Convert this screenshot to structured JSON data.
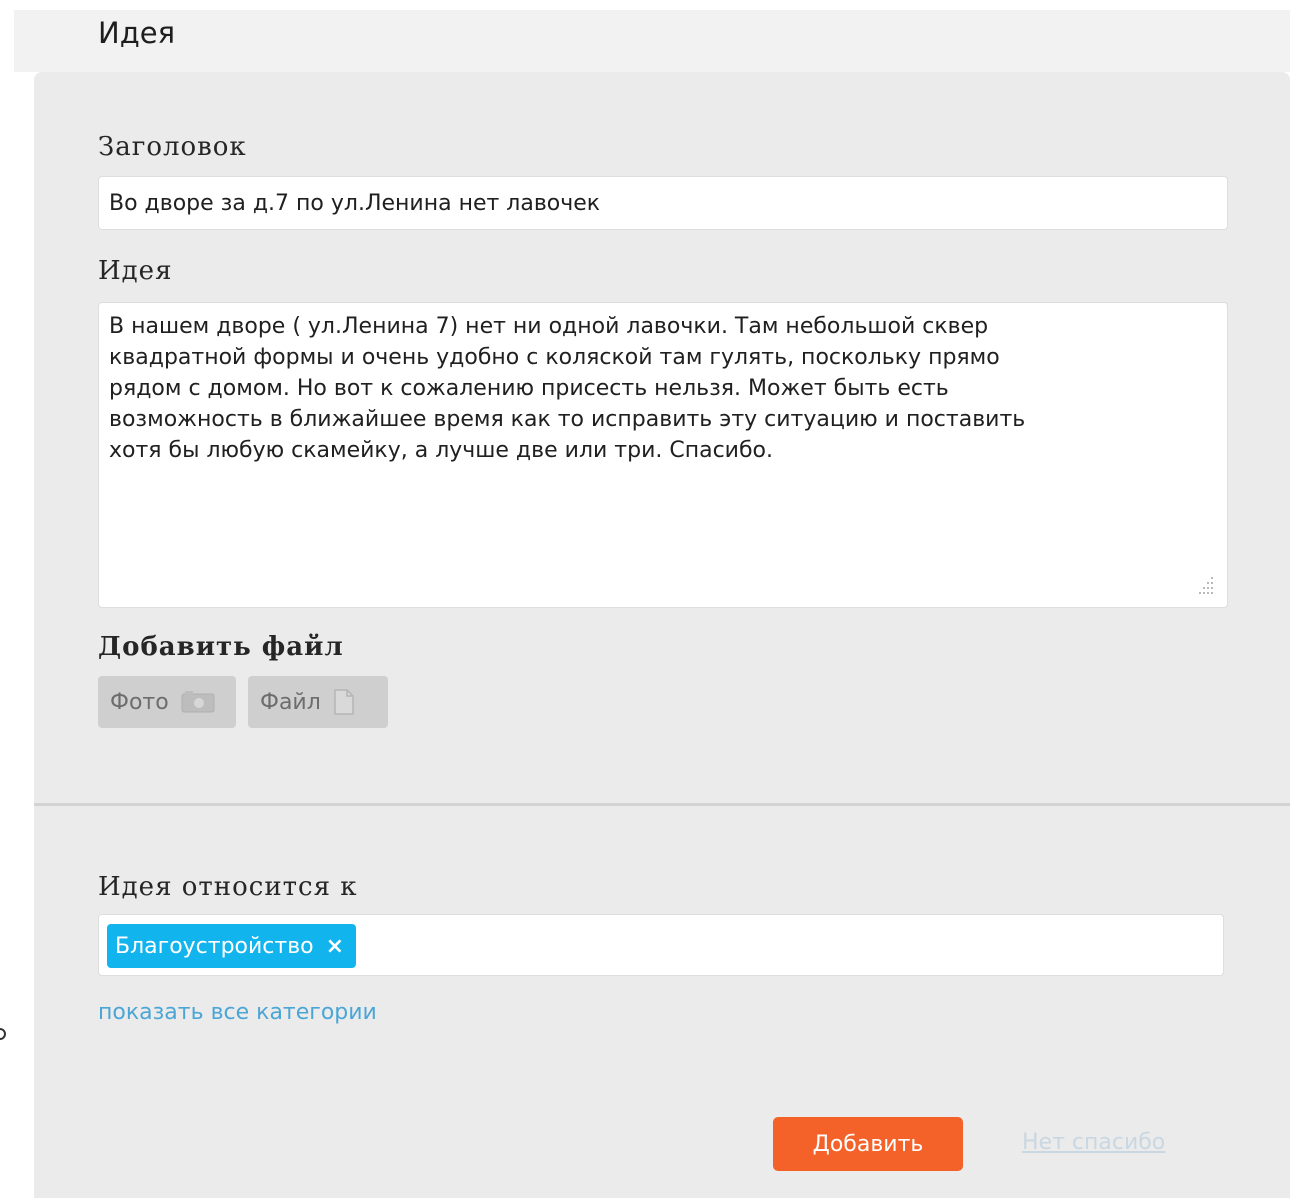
{
  "header": {
    "title": "Идея"
  },
  "form": {
    "title_label": "Заголовок",
    "title_value": "Во дворе за д.7 по ул.Ленина нет лавочек",
    "idea_label": "Идея",
    "idea_value": "В нашем дворе ( ул.Ленина 7) нет ни одной лавочки. Там небольшой сквер\nквадратной формы и очень удобно с коляской там гулять, поскольку прямо\nрядом с домом. Но вот к сожалению присесть нельзя. Может быть есть\nвозможность в ближайшее время как то исправить эту ситуацию и поставить\nхотя бы любую скамейку, а лучше две или три. Спасибо.",
    "attach_label": "Добавить файл",
    "attach_buttons": {
      "photo_label": "Фото",
      "photo_icon": "camera-icon",
      "file_label": "Файл",
      "file_icon": "document-icon"
    }
  },
  "category": {
    "label": "Идея относится к",
    "selected_tag": "Благоустройство",
    "remove_symbol": "×",
    "show_all_link": "показать все категории"
  },
  "actions": {
    "submit_label": "Добавить",
    "decline_label": "Нет спасибо"
  },
  "colors": {
    "accent_orange": "#f4622a",
    "tag_blue": "#12b4ee",
    "link_blue": "#4ba6d6",
    "card_bg": "#ebebeb"
  }
}
